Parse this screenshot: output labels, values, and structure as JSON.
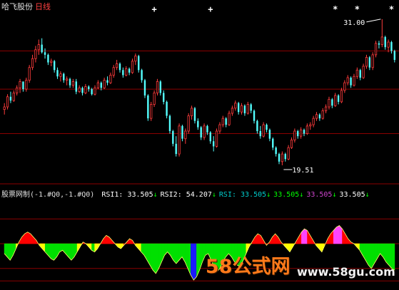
{
  "header": {
    "stock_name": "哈飞股份",
    "period": "日线"
  },
  "indicator": {
    "name": "股票网制",
    "params": "(-1.#Q0,-1.#Q0)",
    "items": [
      {
        "text": "RSI1: 33.505",
        "arrow": "↓",
        "color": "#ffffff",
        "arrow_color": "#00ff00"
      },
      {
        "text": "RSI2: 54.207",
        "arrow": "↓",
        "color": "#ffffff",
        "arrow_color": "#00ff00"
      },
      {
        "text": "RSI: 33.505",
        "arrow": "↓",
        "color": "#00cccc",
        "arrow_color": "#00ff00"
      },
      {
        "text": "33.505",
        "arrow": "↓",
        "color": "#00ff00",
        "arrow_color": "#00ff00"
      },
      {
        "text": "33.505",
        "arrow": "↓",
        "color": "#cc44cc",
        "arrow_color": "#00ff00"
      },
      {
        "text": "33.505",
        "arrow": "↓",
        "color": "#ffffff",
        "arrow_color": "#00ff00"
      }
    ]
  },
  "watermark": {
    "brand": "58公式网",
    "url": "www.58gu.com"
  },
  "colors": {
    "up": "#ff3c3c",
    "down": "#54ffff",
    "grid": "#8b0000",
    "green": "#00e000",
    "red": "#ff0000",
    "yellow": "#ffff00",
    "magenta": "#ff44ff",
    "blue": "#1a1aff"
  },
  "chart_data": [
    {
      "type": "candlestick",
      "title": "",
      "ylim": [
        18.5,
        31.5
      ],
      "annotations": [
        {
          "text": "31.00",
          "value": 31.0,
          "kind": "high"
        },
        {
          "text": "19.51",
          "value": 19.51,
          "kind": "low"
        }
      ],
      "markers": [
        {
          "symbol": "+",
          "index": 48
        },
        {
          "symbol": "+",
          "index": 66
        },
        {
          "symbol": "*",
          "index": 106
        },
        {
          "symbol": "*",
          "index": 113
        },
        {
          "symbol": "*",
          "index": 124
        }
      ],
      "candles": [
        [
          23.9,
          24.4,
          23.5,
          24.1
        ],
        [
          24.1,
          25.1,
          23.9,
          24.9
        ],
        [
          24.9,
          25.3,
          24.4,
          24.6
        ],
        [
          24.6,
          25.4,
          24.5,
          25.2
        ],
        [
          25.2,
          25.8,
          25.0,
          25.6
        ],
        [
          25.6,
          26.3,
          25.2,
          26.1
        ],
        [
          26.1,
          26.0,
          25.3,
          25.5
        ],
        [
          25.5,
          26.4,
          25.3,
          26.2
        ],
        [
          26.2,
          27.4,
          26.0,
          27.2
        ],
        [
          27.2,
          28.2,
          27.0,
          27.9
        ],
        [
          27.9,
          28.9,
          27.6,
          28.6
        ],
        [
          28.6,
          29.4,
          28.2,
          29.0
        ],
        [
          29.0,
          29.5,
          28.3,
          28.4
        ],
        [
          28.4,
          28.7,
          27.9,
          28.2
        ],
        [
          28.2,
          28.3,
          27.4,
          27.6
        ],
        [
          27.6,
          27.9,
          27.3,
          27.7
        ],
        [
          27.7,
          27.8,
          26.8,
          27.0
        ],
        [
          27.0,
          27.2,
          26.3,
          26.5
        ],
        [
          26.5,
          26.9,
          26.1,
          26.7
        ],
        [
          26.7,
          26.8,
          26.0,
          26.2
        ],
        [
          26.2,
          26.5,
          25.8,
          26.3
        ],
        [
          26.3,
          26.4,
          25.6,
          25.8
        ],
        [
          25.8,
          26.3,
          25.6,
          26.1
        ],
        [
          26.1,
          26.3,
          25.1,
          25.3
        ],
        [
          25.3,
          25.8,
          25.2,
          25.6
        ],
        [
          25.6,
          25.7,
          25.0,
          25.2
        ],
        [
          25.2,
          25.9,
          25.1,
          25.7
        ],
        [
          25.7,
          25.8,
          25.3,
          25.5
        ],
        [
          25.5,
          25.6,
          25.0,
          25.1
        ],
        [
          25.1,
          25.8,
          25.0,
          25.6
        ],
        [
          25.6,
          26.2,
          25.5,
          26.0
        ],
        [
          26.0,
          26.1,
          25.4,
          25.6
        ],
        [
          25.6,
          26.4,
          25.5,
          26.2
        ],
        [
          26.2,
          26.5,
          25.8,
          26.0
        ],
        [
          26.0,
          26.8,
          25.9,
          26.6
        ],
        [
          26.6,
          27.4,
          26.4,
          27.2
        ],
        [
          27.2,
          27.8,
          27.0,
          27.5
        ],
        [
          27.5,
          27.6,
          26.8,
          27.0
        ],
        [
          27.0,
          27.2,
          26.4,
          26.6
        ],
        [
          26.6,
          27.3,
          26.5,
          27.1
        ],
        [
          27.1,
          27.2,
          26.6,
          26.8
        ],
        [
          26.8,
          27.9,
          26.7,
          27.7
        ],
        [
          27.7,
          28.3,
          27.4,
          28.1
        ],
        [
          28.1,
          28.2,
          26.8,
          27.0
        ],
        [
          27.0,
          27.1,
          26.0,
          26.2
        ],
        [
          26.2,
          26.3,
          24.8,
          25.0
        ],
        [
          25.0,
          25.1,
          23.0,
          23.2
        ],
        [
          23.2,
          24.5,
          23.0,
          24.3
        ],
        [
          24.3,
          25.4,
          24.1,
          25.2
        ],
        [
          25.2,
          26.3,
          25.0,
          26.1
        ],
        [
          26.1,
          26.2,
          25.0,
          25.2
        ],
        [
          25.2,
          25.4,
          24.3,
          24.5
        ],
        [
          24.5,
          24.6,
          23.2,
          23.4
        ],
        [
          23.4,
          23.5,
          22.0,
          22.2
        ],
        [
          22.2,
          22.3,
          21.0,
          21.2
        ],
        [
          21.2,
          21.8,
          20.2,
          20.4
        ],
        [
          20.4,
          22.8,
          20.2,
          22.6
        ],
        [
          22.6,
          22.7,
          21.4,
          21.6
        ],
        [
          21.6,
          22.4,
          21.2,
          22.2
        ],
        [
          22.2,
          23.6,
          22.0,
          23.4
        ],
        [
          23.4,
          24.2,
          23.1,
          24.0
        ],
        [
          24.0,
          24.1,
          22.8,
          23.0
        ],
        [
          23.0,
          23.2,
          22.3,
          22.5
        ],
        [
          22.5,
          22.6,
          21.5,
          21.7
        ],
        [
          21.7,
          22.8,
          21.5,
          22.6
        ],
        [
          22.6,
          22.7,
          21.9,
          22.1
        ],
        [
          22.1,
          22.2,
          21.2,
          21.4
        ],
        [
          21.4,
          21.8,
          20.6,
          21.0
        ],
        [
          21.0,
          22.4,
          20.9,
          22.2
        ],
        [
          22.2,
          22.9,
          22.0,
          22.7
        ],
        [
          22.7,
          23.4,
          22.5,
          23.2
        ],
        [
          23.2,
          23.3,
          22.5,
          22.7
        ],
        [
          22.7,
          23.8,
          22.6,
          23.6
        ],
        [
          23.6,
          24.2,
          23.4,
          24.0
        ],
        [
          24.0,
          24.6,
          23.8,
          24.4
        ],
        [
          24.4,
          24.5,
          23.5,
          23.7
        ],
        [
          23.7,
          24.4,
          23.5,
          24.2
        ],
        [
          24.2,
          24.3,
          23.4,
          23.6
        ],
        [
          23.6,
          24.5,
          23.5,
          24.3
        ],
        [
          24.3,
          24.4,
          23.6,
          23.8
        ],
        [
          23.8,
          23.9,
          22.8,
          23.0
        ],
        [
          23.0,
          23.1,
          22.0,
          22.2
        ],
        [
          22.2,
          22.6,
          21.6,
          21.8
        ],
        [
          21.8,
          22.9,
          21.7,
          22.7
        ],
        [
          22.7,
          22.8,
          22.1,
          22.3
        ],
        [
          22.3,
          22.4,
          21.4,
          21.6
        ],
        [
          21.6,
          21.7,
          20.7,
          20.9
        ],
        [
          20.9,
          21.0,
          20.2,
          20.4
        ],
        [
          20.4,
          20.5,
          19.6,
          19.8
        ],
        [
          19.8,
          20.6,
          19.51,
          20.4
        ],
        [
          20.4,
          20.5,
          19.8,
          20.0
        ],
        [
          20.0,
          21.1,
          19.9,
          20.9
        ],
        [
          20.9,
          21.7,
          20.8,
          21.5
        ],
        [
          21.5,
          22.4,
          21.3,
          22.2
        ],
        [
          22.2,
          22.3,
          21.6,
          21.8
        ],
        [
          21.8,
          22.5,
          21.6,
          22.3
        ],
        [
          22.3,
          22.4,
          21.8,
          22.0
        ],
        [
          22.0,
          22.8,
          21.9,
          22.6
        ],
        [
          22.6,
          22.9,
          22.3,
          22.7
        ],
        [
          22.7,
          23.4,
          22.5,
          23.2
        ],
        [
          23.2,
          23.7,
          23.0,
          23.5
        ],
        [
          23.5,
          23.6,
          23.0,
          23.2
        ],
        [
          23.2,
          24.0,
          23.1,
          23.8
        ],
        [
          23.8,
          24.3,
          23.6,
          24.1
        ],
        [
          24.1,
          24.9,
          23.9,
          24.7
        ],
        [
          24.7,
          24.8,
          24.0,
          24.2
        ],
        [
          24.2,
          25.2,
          24.1,
          25.0
        ],
        [
          25.0,
          25.1,
          24.3,
          24.5
        ],
        [
          24.5,
          25.6,
          24.4,
          25.4
        ],
        [
          25.4,
          26.2,
          25.2,
          26.0
        ],
        [
          26.0,
          26.6,
          25.8,
          26.4
        ],
        [
          26.4,
          26.5,
          25.6,
          25.8
        ],
        [
          25.8,
          26.7,
          25.7,
          26.5
        ],
        [
          26.5,
          27.2,
          26.3,
          27.0
        ],
        [
          27.0,
          27.1,
          26.2,
          26.4
        ],
        [
          26.4,
          27.5,
          26.3,
          27.3
        ],
        [
          27.3,
          28.2,
          27.1,
          28.0
        ],
        [
          28.0,
          28.1,
          27.0,
          27.2
        ],
        [
          27.2,
          28.4,
          27.0,
          28.2
        ],
        [
          28.2,
          29.3,
          28.0,
          29.1
        ],
        [
          29.1,
          29.3,
          28.7,
          29.0
        ],
        [
          29.0,
          31.0,
          28.8,
          29.6
        ],
        [
          29.6,
          29.7,
          28.6,
          28.8
        ],
        [
          28.8,
          29.4,
          28.4,
          29.2
        ],
        [
          29.2,
          29.3,
          28.3,
          28.5
        ],
        [
          28.5,
          28.6,
          27.6,
          27.8
        ]
      ]
    },
    {
      "type": "area",
      "title": "股票网制",
      "ylim": [
        0,
        100
      ],
      "reference_lines": [
        80,
        50,
        20,
        5
      ],
      "values": [
        38,
        34,
        30,
        36,
        44,
        52,
        58,
        62,
        64,
        62,
        58,
        54,
        48,
        44,
        40,
        36,
        32,
        30,
        34,
        40,
        42,
        38,
        34,
        30,
        34,
        40,
        46,
        52,
        50,
        46,
        42,
        40,
        44,
        50,
        56,
        60,
        58,
        54,
        50,
        46,
        44,
        48,
        52,
        56,
        54,
        48,
        44,
        40,
        36,
        30,
        24,
        18,
        14,
        20,
        28,
        36,
        40,
        36,
        30,
        26,
        30,
        34,
        28,
        20,
        12,
        6,
        10,
        18,
        28,
        36,
        38,
        30,
        22,
        16,
        20,
        28,
        34,
        38,
        34,
        28,
        24,
        22,
        30,
        38,
        46,
        52,
        58,
        62,
        60,
        54,
        48,
        52,
        58,
        62,
        58,
        52,
        48,
        44,
        40,
        46,
        52,
        58,
        64,
        68,
        66,
        60,
        54,
        48,
        44,
        40,
        48,
        56,
        62,
        66,
        70,
        72,
        68,
        62,
        56,
        52,
        50,
        46,
        42,
        36,
        30,
        24,
        20,
        26,
        32,
        38,
        34,
        28,
        24,
        20,
        18
      ]
    }
  ]
}
